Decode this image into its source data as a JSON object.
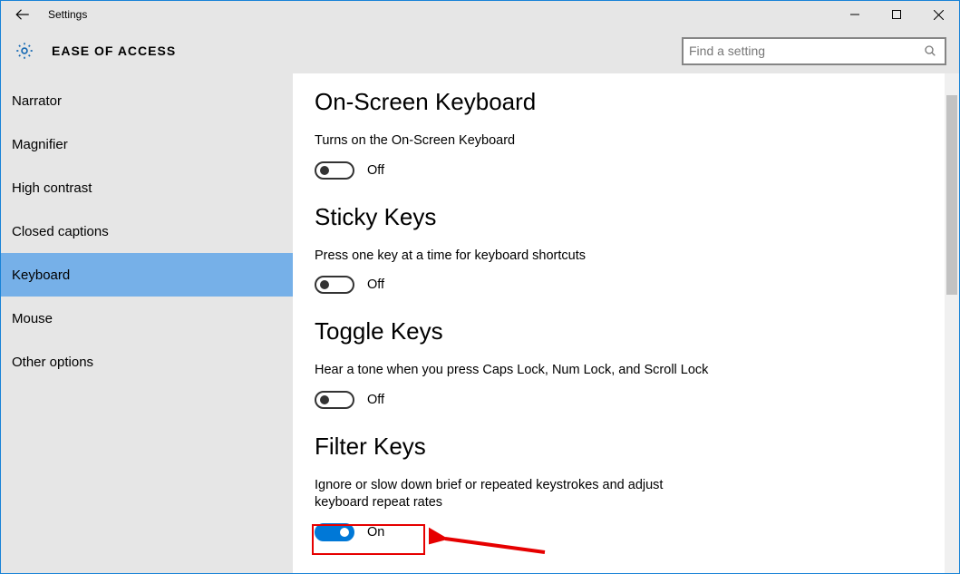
{
  "window": {
    "title": "Settings"
  },
  "header": {
    "category": "EASE OF ACCESS"
  },
  "search": {
    "placeholder": "Find a setting"
  },
  "sidebar": {
    "items": [
      {
        "label": "Narrator",
        "selected": false
      },
      {
        "label": "Magnifier",
        "selected": false
      },
      {
        "label": "High contrast",
        "selected": false
      },
      {
        "label": "Closed captions",
        "selected": false
      },
      {
        "label": "Keyboard",
        "selected": true
      },
      {
        "label": "Mouse",
        "selected": false
      },
      {
        "label": "Other options",
        "selected": false
      }
    ]
  },
  "sections": {
    "osk": {
      "title": "On-Screen Keyboard",
      "desc": "Turns on the On-Screen Keyboard",
      "state_label": "Off",
      "on": false
    },
    "sticky": {
      "title": "Sticky Keys",
      "desc": "Press one key at a time for keyboard shortcuts",
      "state_label": "Off",
      "on": false
    },
    "toggle": {
      "title": "Toggle Keys",
      "desc": "Hear a tone when you press Caps Lock, Num Lock, and Scroll Lock",
      "state_label": "Off",
      "on": false
    },
    "filter": {
      "title": "Filter Keys",
      "desc": "Ignore or slow down brief or repeated keystrokes and adjust keyboard repeat rates",
      "state_label": "On",
      "on": true
    }
  },
  "annotation": {
    "highlight_target": "filter-keys-toggle"
  }
}
